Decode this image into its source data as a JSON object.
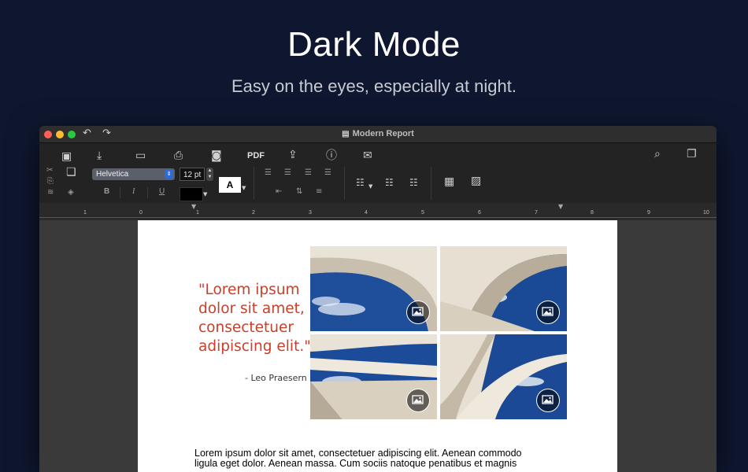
{
  "hero": {
    "title": "Dark Mode",
    "subtitle": "Easy on the eyes, especially at night."
  },
  "window": {
    "title": "Modern Report",
    "doc_icon": "document-icon"
  },
  "toolbar": {
    "pdf_label": "PDF",
    "font_name": "Helvetica",
    "font_size": "12 pt",
    "text_color_label": "A",
    "bold_label": "B",
    "italic_label": "I",
    "underline_label": "U"
  },
  "ruler": {
    "labels": [
      "1",
      "0",
      "1",
      "2",
      "3",
      "4",
      "5",
      "6",
      "7",
      "8",
      "9",
      "10"
    ]
  },
  "document": {
    "quote": "\"Lorem ipsum dolor sit amet, consectetuer adipiscing elit.\"",
    "quote_author": "- Leo Praesern",
    "body_line1": "Lorem ipsum dolor sit amet, consectetuer adipiscing elit. Aenean commodo",
    "body_line2": "ligula eget dolor. Aenean massa. Cum sociis natoque penatibus et magnis"
  },
  "colors": {
    "background": "#0f1730",
    "quote": "#c9402a",
    "window": "#1f1f1f"
  }
}
